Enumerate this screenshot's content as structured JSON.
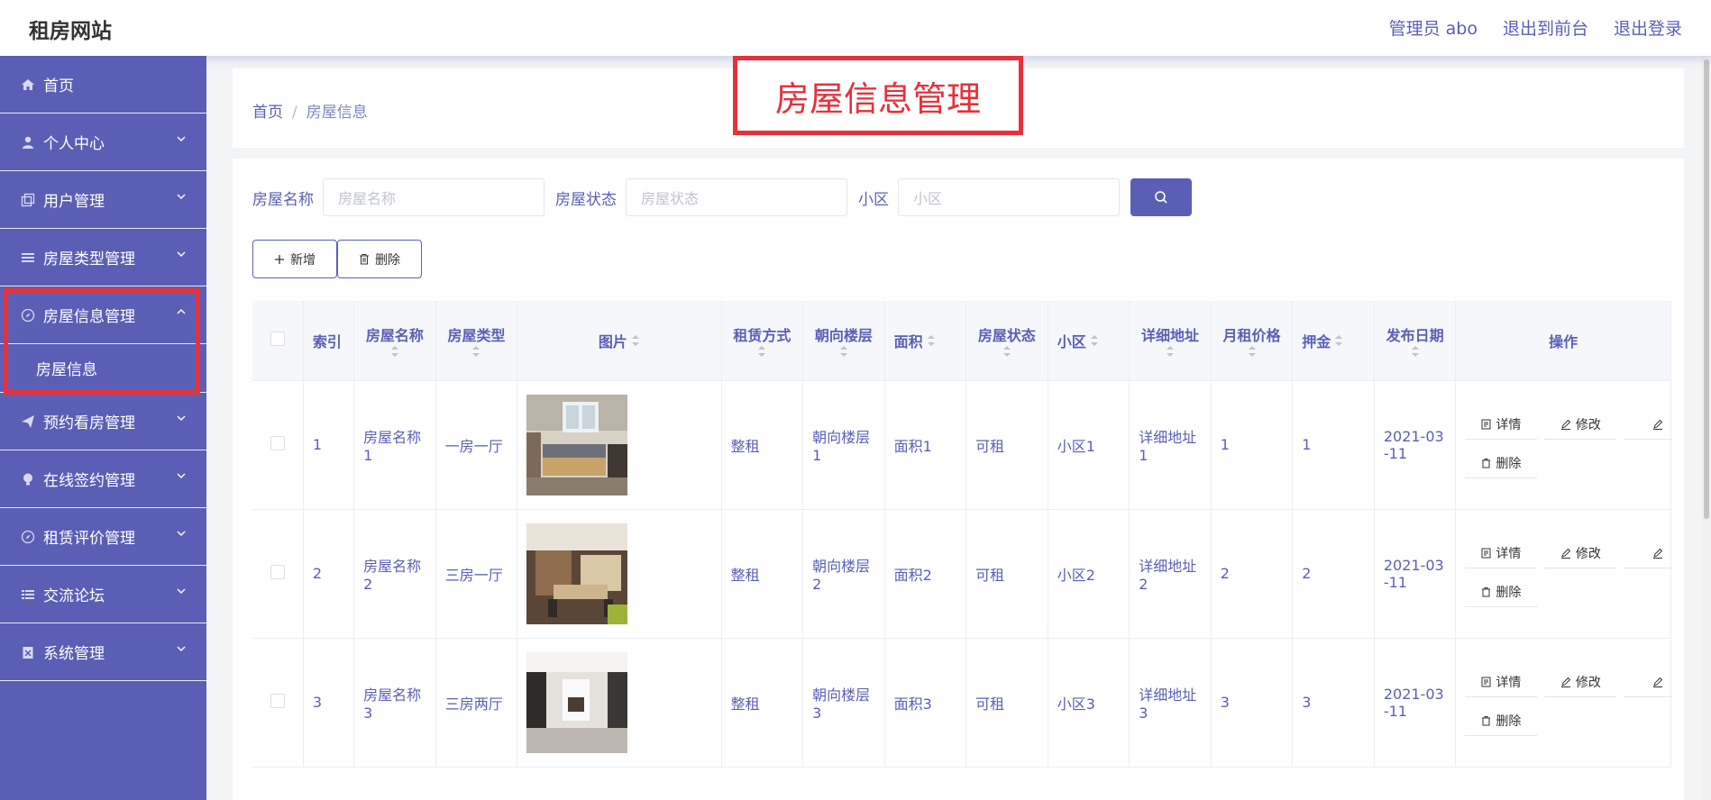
{
  "brand": "租房网站",
  "top_links": [
    "管理员 abo",
    "退出到前台",
    "退出登录"
  ],
  "sidebar": {
    "items": [
      {
        "label": "首页",
        "icon": "home-icon"
      },
      {
        "label": "个人中心",
        "icon": "user-icon"
      },
      {
        "label": "用户管理",
        "icon": "copy-icon"
      },
      {
        "label": "房屋类型管理",
        "icon": "list-icon"
      },
      {
        "label": "房屋信息管理",
        "icon": "compass-icon"
      },
      {
        "label": "预约看房管理",
        "icon": "send-icon"
      },
      {
        "label": "在线签约管理",
        "icon": "bulb-icon"
      },
      {
        "label": "租赁评价管理",
        "icon": "compass-icon"
      },
      {
        "label": "交流论坛",
        "icon": "list-icon"
      },
      {
        "label": "系统管理",
        "icon": "clipboard-icon"
      }
    ],
    "active_sub": "房屋信息"
  },
  "breadcrumb": {
    "home": "首页",
    "current": "房屋信息"
  },
  "annotation_title": "房屋信息管理",
  "filters": [
    {
      "label": "房屋名称",
      "placeholder": "房屋名称"
    },
    {
      "label": "房屋状态",
      "placeholder": "房屋状态"
    },
    {
      "label": "小区",
      "placeholder": "小区"
    }
  ],
  "actions": {
    "add": "新增",
    "delete": "删除"
  },
  "table": {
    "columns": {
      "index": "索引",
      "name": "房屋名称",
      "type": "房屋类型",
      "image": "图片",
      "rent_mode": "租赁方式",
      "orientation": "朝向楼层",
      "area": "面积",
      "status": "房屋状态",
      "community": "小区",
      "address": "详细地址",
      "price": "月租价格",
      "deposit": "押金",
      "date": "发布日期",
      "ops": "操作"
    },
    "rows": [
      {
        "index": "1",
        "name_a": "房屋名称",
        "name_b": "1",
        "type": "一房一厅",
        "rent_mode": "整租",
        "orientation_a": "朝向楼层",
        "orientation_b": "1",
        "area": "面积1",
        "status": "可租",
        "community": "小区1",
        "address_a": "详细地址",
        "address_b": "1",
        "price": "1",
        "deposit": "1",
        "date_a": "2021-03",
        "date_b": "-11"
      },
      {
        "index": "2",
        "name_a": "房屋名称",
        "name_b": "2",
        "type": "三房一厅",
        "rent_mode": "整租",
        "orientation_a": "朝向楼层",
        "orientation_b": "2",
        "area": "面积2",
        "status": "可租",
        "community": "小区2",
        "address_a": "详细地址",
        "address_b": "2",
        "price": "2",
        "deposit": "2",
        "date_a": "2021-03",
        "date_b": "-11"
      },
      {
        "index": "3",
        "name_a": "房屋名称",
        "name_b": "3",
        "type": "三房两厅",
        "rent_mode": "整租",
        "orientation_a": "朝向楼层",
        "orientation_b": "3",
        "area": "面积3",
        "status": "可租",
        "community": "小区3",
        "address_a": "详细地址",
        "address_b": "3",
        "price": "3",
        "deposit": "3",
        "date_a": "2021-03",
        "date_b": "-11"
      }
    ],
    "op_labels": {
      "detail": "详情",
      "edit": "修改",
      "delete": "删除"
    }
  },
  "colors": {
    "primary": "#5a5fb5",
    "highlight": "#e8303a"
  }
}
